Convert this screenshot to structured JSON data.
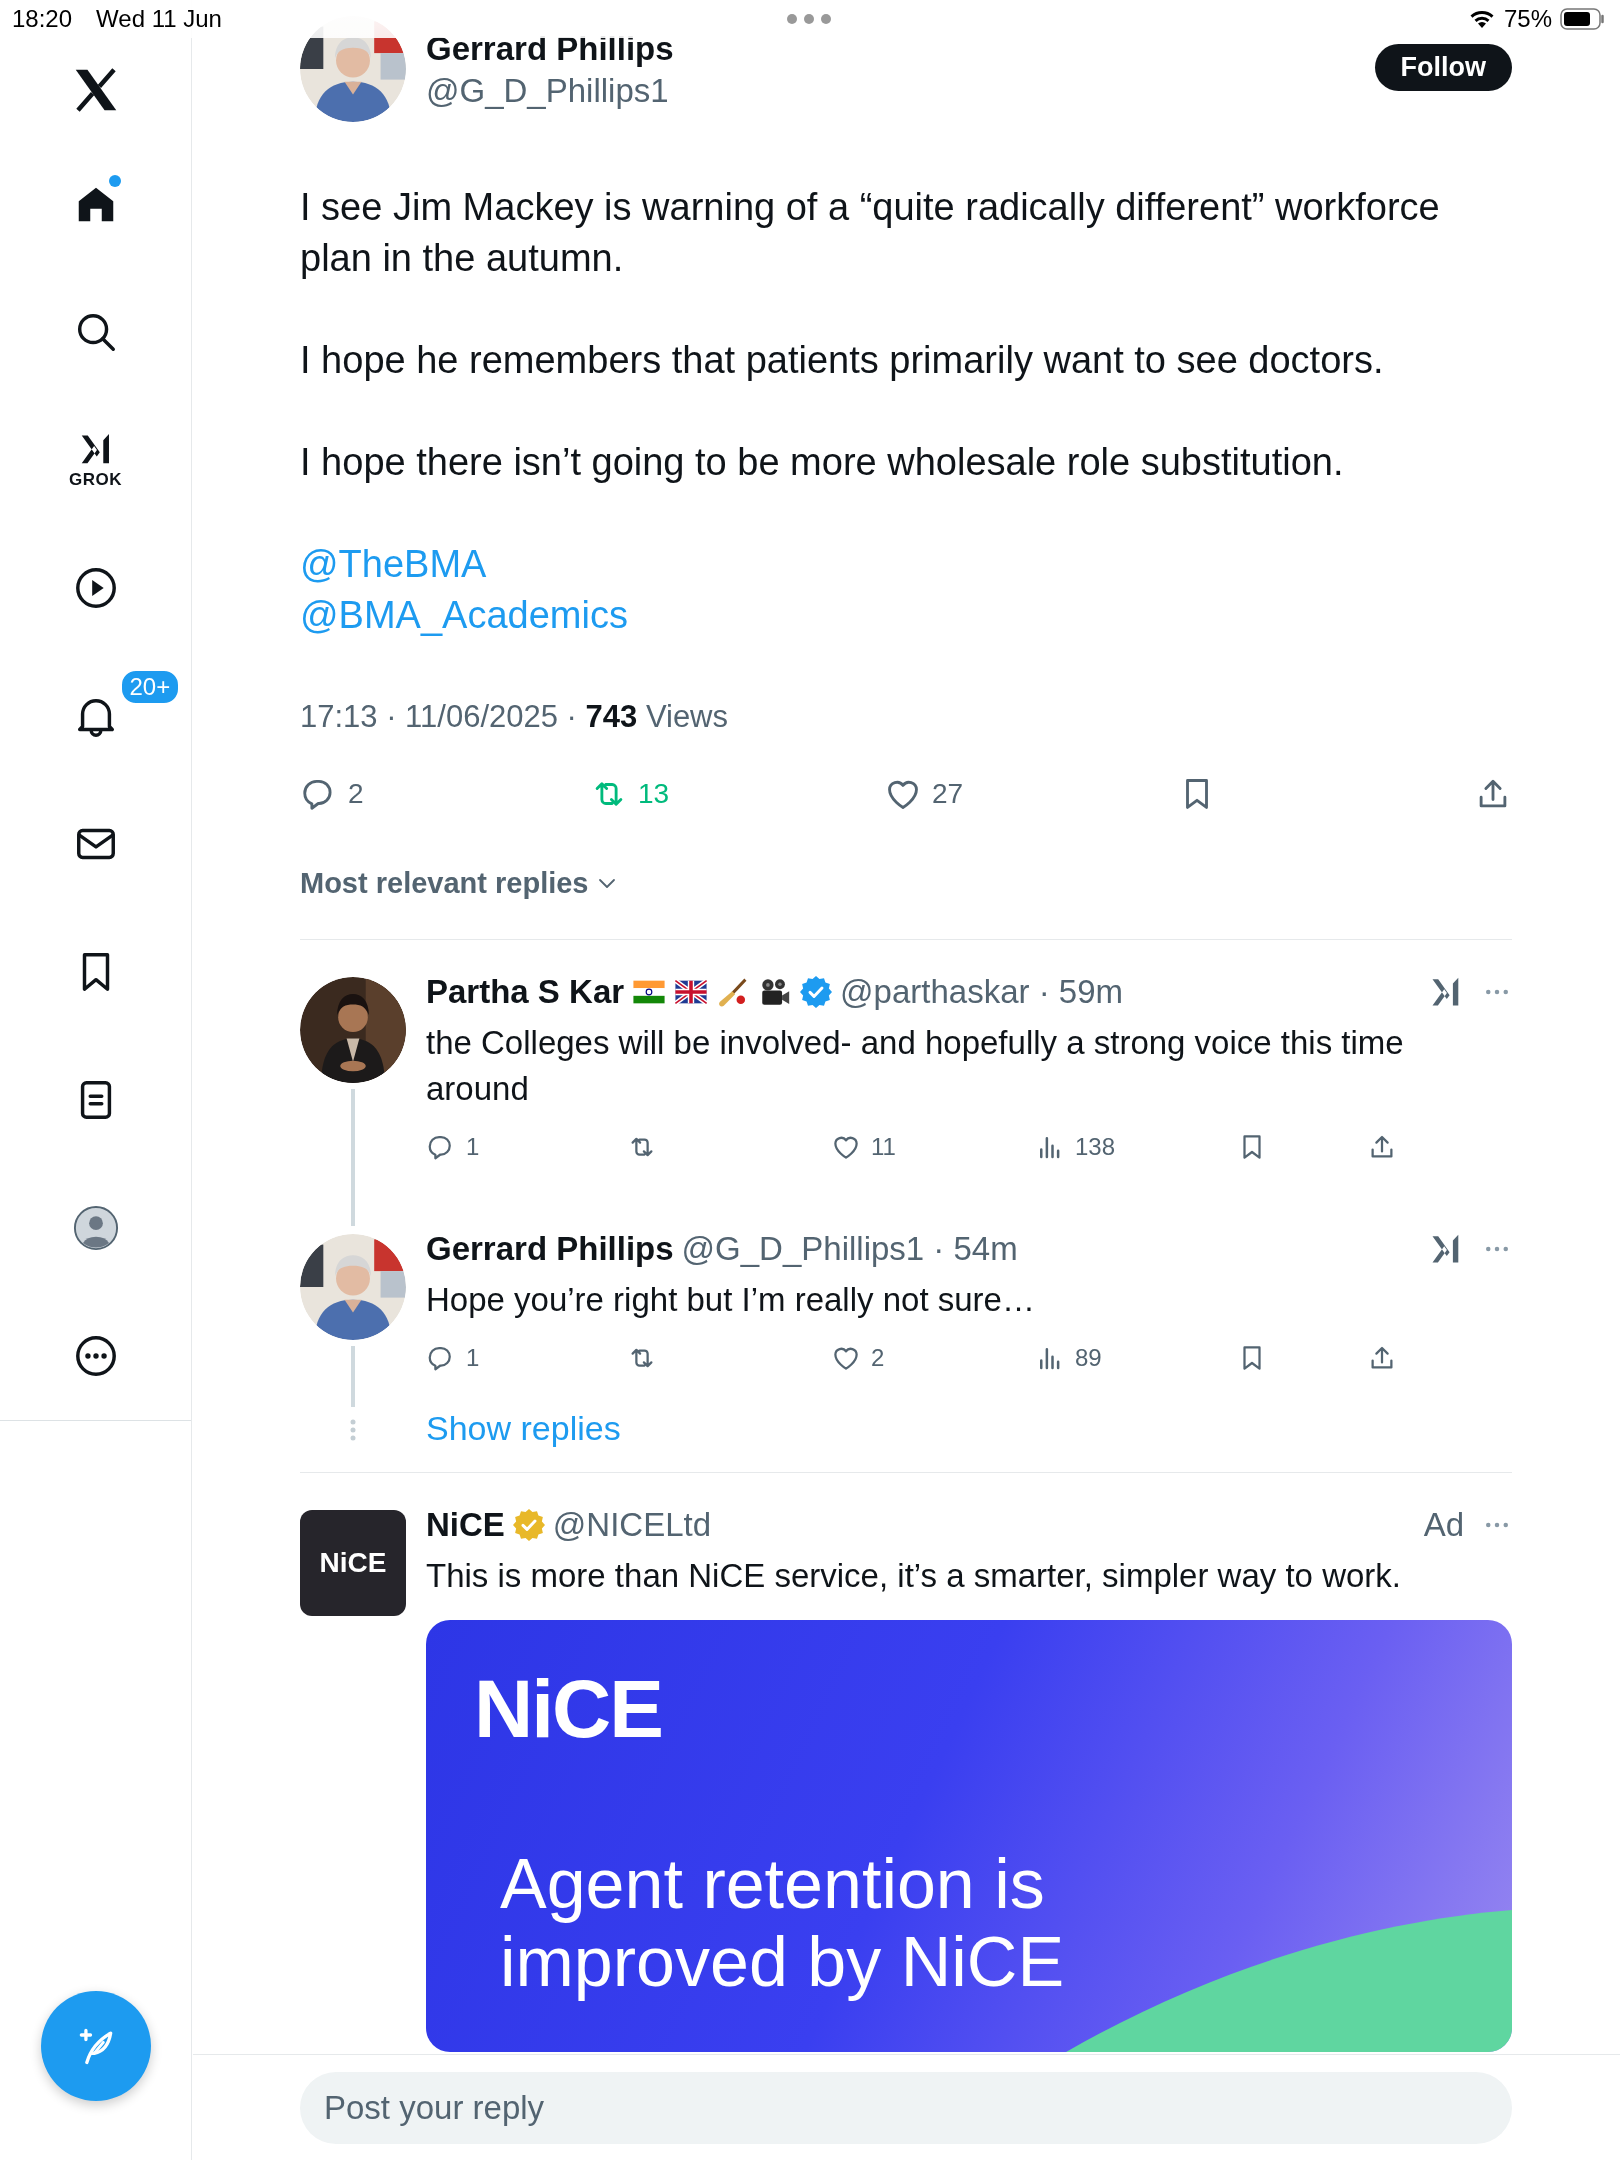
{
  "status_bar": {
    "time": "18:20",
    "date": "Wed 11 Jun",
    "battery": "75%"
  },
  "sidebar": {
    "items": [
      {
        "kind": "logo"
      },
      {
        "kind": "home",
        "has_new": true
      },
      {
        "kind": "search"
      },
      {
        "kind": "grok",
        "label": "GROK"
      },
      {
        "kind": "video"
      },
      {
        "kind": "notifications",
        "badge": "20+"
      },
      {
        "kind": "messages"
      },
      {
        "kind": "bookmarks"
      },
      {
        "kind": "lists"
      },
      {
        "kind": "profile"
      },
      {
        "kind": "more"
      }
    ]
  },
  "post": {
    "author": {
      "name": "Gerrard Phillips",
      "handle": "@G_D_Phillips1"
    },
    "follow_button": "Follow",
    "paragraphs": [
      "I see Jim Mackey is warning of a “quite radically different” workforce plan in the autumn.",
      "I hope he remembers that patients primarily want to see doctors.",
      "I hope there isn’t going to be more wholesale role substitution."
    ],
    "mentions": [
      "@TheBMA",
      "@BMA_Academics"
    ],
    "meta": "17:13 · 11/06/2025 · **743** Views",
    "actions": [
      {
        "kind": "reply",
        "count": "2"
      },
      {
        "kind": "repost",
        "count": "13",
        "active": true
      },
      {
        "kind": "like",
        "count": "27",
        "active": false
      },
      {
        "kind": "bookmark"
      },
      {
        "kind": "share"
      }
    ]
  },
  "replies_sort": "Most relevant replies",
  "replies": [
    {
      "name": "Partha S Kar",
      "emoji_icons": [
        {
          "kind": "india_flag"
        },
        {
          "kind": "uk_flag"
        },
        {
          "kind": "cricket"
        },
        {
          "kind": "film_camera"
        }
      ],
      "verified_badge": {
        "color": "#1d9bf0"
      },
      "meta": "@parthaskar · 59m",
      "text": "the Colleges will be involved- and hopefully a strong voice this time around",
      "actions": [
        {
          "kind": "reply",
          "count": "1"
        },
        {
          "kind": "repost"
        },
        {
          "kind": "like",
          "count": "11"
        },
        {
          "kind": "views",
          "count": "138"
        },
        {
          "kind": "bookmark"
        },
        {
          "kind": "share"
        }
      ]
    },
    {
      "name": "Gerrard Phillips",
      "meta": "@G_D_Phillips1 · 54m",
      "text": "Hope you’re right but I’m really not sure…",
      "actions": [
        {
          "kind": "reply",
          "count": "1"
        },
        {
          "kind": "repost"
        },
        {
          "kind": "like",
          "count": "2"
        },
        {
          "kind": "views",
          "count": "89"
        },
        {
          "kind": "bookmark"
        },
        {
          "kind": "share"
        }
      ]
    }
  ],
  "show_replies": "Show replies",
  "ad": {
    "name": "NiCE",
    "verified_badge": {
      "color": "#e8b829"
    },
    "handle": "@NICELtd",
    "label": "Ad",
    "logo": "NiCE",
    "text": "This is more than NiCE service, it’s a smarter, simpler way to work.",
    "banner": {
      "logo": "NiCE",
      "headline": "Agent retention is improved by NiCE"
    }
  },
  "reply_box": {
    "placeholder": "Post your reply"
  }
}
